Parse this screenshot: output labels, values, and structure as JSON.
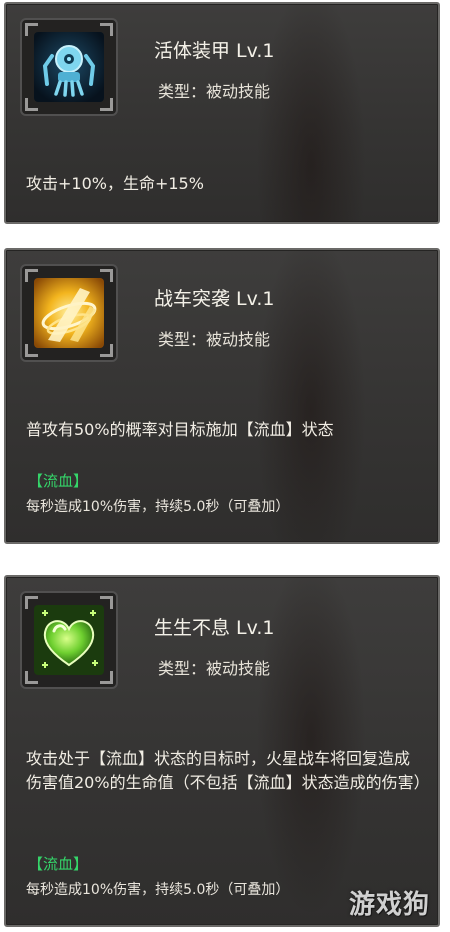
{
  "skills": [
    {
      "name": "活体装甲 Lv.1",
      "type": "类型：被动技能",
      "description": "攻击+10%，生命+15%",
      "icon": "robot-armor-icon",
      "icon_color": "#3fb7e0"
    },
    {
      "name": "战车突袭 Lv.1",
      "type": "类型：被动技能",
      "description": "普攻有50%的概率对目标施加【流血】状态",
      "tag": "【流血】",
      "tag_detail": "每秒造成10%伤害，持续5.0秒（可叠加）",
      "icon": "chariot-assault-icon",
      "icon_color": "#f0b21c"
    },
    {
      "name": "生生不息 Lv.1",
      "type": "类型：被动技能",
      "description": "攻击处于【流血】状态的目标时，火星战车将回复造成伤害值20%的生命值（不包括【流血】状态造成的伤害）",
      "tag": "【流血】",
      "tag_detail": "每秒造成10%伤害，持续5.0秒（可叠加）",
      "icon": "heart-regen-icon",
      "icon_color": "#6fd030"
    }
  ],
  "watermark": "游戏狗",
  "colors": {
    "card_bg": "#383736",
    "card_border": "#6b6a68",
    "tag_green": "#35d56a",
    "text_white": "#f1ede4"
  }
}
